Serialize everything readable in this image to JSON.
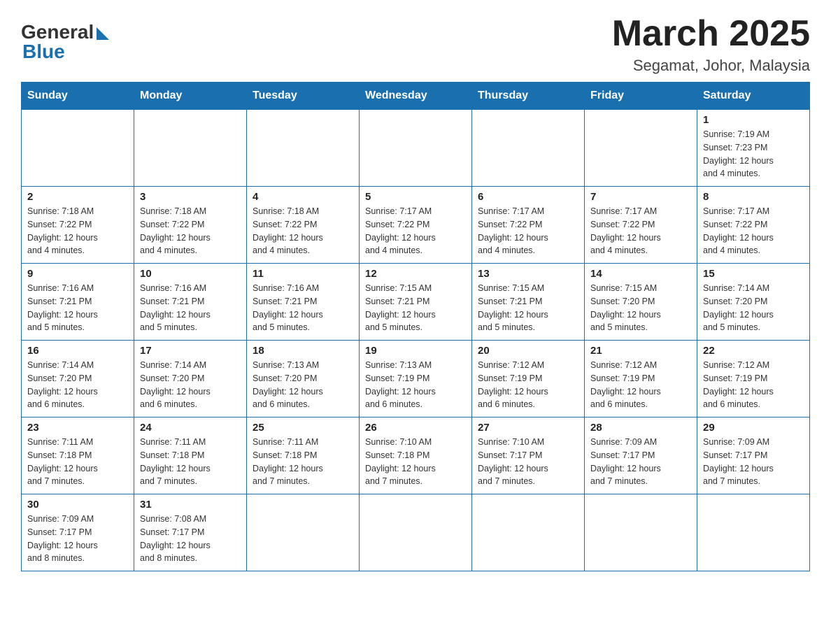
{
  "header": {
    "logo_general": "General",
    "logo_blue": "Blue",
    "main_title": "March 2025",
    "subtitle": "Segamat, Johor, Malaysia"
  },
  "weekdays": [
    "Sunday",
    "Monday",
    "Tuesday",
    "Wednesday",
    "Thursday",
    "Friday",
    "Saturday"
  ],
  "weeks": [
    [
      {
        "day": "",
        "info": ""
      },
      {
        "day": "",
        "info": ""
      },
      {
        "day": "",
        "info": ""
      },
      {
        "day": "",
        "info": ""
      },
      {
        "day": "",
        "info": ""
      },
      {
        "day": "",
        "info": ""
      },
      {
        "day": "1",
        "info": "Sunrise: 7:19 AM\nSunset: 7:23 PM\nDaylight: 12 hours\nand 4 minutes."
      }
    ],
    [
      {
        "day": "2",
        "info": "Sunrise: 7:18 AM\nSunset: 7:22 PM\nDaylight: 12 hours\nand 4 minutes."
      },
      {
        "day": "3",
        "info": "Sunrise: 7:18 AM\nSunset: 7:22 PM\nDaylight: 12 hours\nand 4 minutes."
      },
      {
        "day": "4",
        "info": "Sunrise: 7:18 AM\nSunset: 7:22 PM\nDaylight: 12 hours\nand 4 minutes."
      },
      {
        "day": "5",
        "info": "Sunrise: 7:17 AM\nSunset: 7:22 PM\nDaylight: 12 hours\nand 4 minutes."
      },
      {
        "day": "6",
        "info": "Sunrise: 7:17 AM\nSunset: 7:22 PM\nDaylight: 12 hours\nand 4 minutes."
      },
      {
        "day": "7",
        "info": "Sunrise: 7:17 AM\nSunset: 7:22 PM\nDaylight: 12 hours\nand 4 minutes."
      },
      {
        "day": "8",
        "info": "Sunrise: 7:17 AM\nSunset: 7:22 PM\nDaylight: 12 hours\nand 4 minutes."
      }
    ],
    [
      {
        "day": "9",
        "info": "Sunrise: 7:16 AM\nSunset: 7:21 PM\nDaylight: 12 hours\nand 5 minutes."
      },
      {
        "day": "10",
        "info": "Sunrise: 7:16 AM\nSunset: 7:21 PM\nDaylight: 12 hours\nand 5 minutes."
      },
      {
        "day": "11",
        "info": "Sunrise: 7:16 AM\nSunset: 7:21 PM\nDaylight: 12 hours\nand 5 minutes."
      },
      {
        "day": "12",
        "info": "Sunrise: 7:15 AM\nSunset: 7:21 PM\nDaylight: 12 hours\nand 5 minutes."
      },
      {
        "day": "13",
        "info": "Sunrise: 7:15 AM\nSunset: 7:21 PM\nDaylight: 12 hours\nand 5 minutes."
      },
      {
        "day": "14",
        "info": "Sunrise: 7:15 AM\nSunset: 7:20 PM\nDaylight: 12 hours\nand 5 minutes."
      },
      {
        "day": "15",
        "info": "Sunrise: 7:14 AM\nSunset: 7:20 PM\nDaylight: 12 hours\nand 5 minutes."
      }
    ],
    [
      {
        "day": "16",
        "info": "Sunrise: 7:14 AM\nSunset: 7:20 PM\nDaylight: 12 hours\nand 6 minutes."
      },
      {
        "day": "17",
        "info": "Sunrise: 7:14 AM\nSunset: 7:20 PM\nDaylight: 12 hours\nand 6 minutes."
      },
      {
        "day": "18",
        "info": "Sunrise: 7:13 AM\nSunset: 7:20 PM\nDaylight: 12 hours\nand 6 minutes."
      },
      {
        "day": "19",
        "info": "Sunrise: 7:13 AM\nSunset: 7:19 PM\nDaylight: 12 hours\nand 6 minutes."
      },
      {
        "day": "20",
        "info": "Sunrise: 7:12 AM\nSunset: 7:19 PM\nDaylight: 12 hours\nand 6 minutes."
      },
      {
        "day": "21",
        "info": "Sunrise: 7:12 AM\nSunset: 7:19 PM\nDaylight: 12 hours\nand 6 minutes."
      },
      {
        "day": "22",
        "info": "Sunrise: 7:12 AM\nSunset: 7:19 PM\nDaylight: 12 hours\nand 6 minutes."
      }
    ],
    [
      {
        "day": "23",
        "info": "Sunrise: 7:11 AM\nSunset: 7:18 PM\nDaylight: 12 hours\nand 7 minutes."
      },
      {
        "day": "24",
        "info": "Sunrise: 7:11 AM\nSunset: 7:18 PM\nDaylight: 12 hours\nand 7 minutes."
      },
      {
        "day": "25",
        "info": "Sunrise: 7:11 AM\nSunset: 7:18 PM\nDaylight: 12 hours\nand 7 minutes."
      },
      {
        "day": "26",
        "info": "Sunrise: 7:10 AM\nSunset: 7:18 PM\nDaylight: 12 hours\nand 7 minutes."
      },
      {
        "day": "27",
        "info": "Sunrise: 7:10 AM\nSunset: 7:17 PM\nDaylight: 12 hours\nand 7 minutes."
      },
      {
        "day": "28",
        "info": "Sunrise: 7:09 AM\nSunset: 7:17 PM\nDaylight: 12 hours\nand 7 minutes."
      },
      {
        "day": "29",
        "info": "Sunrise: 7:09 AM\nSunset: 7:17 PM\nDaylight: 12 hours\nand 7 minutes."
      }
    ],
    [
      {
        "day": "30",
        "info": "Sunrise: 7:09 AM\nSunset: 7:17 PM\nDaylight: 12 hours\nand 8 minutes."
      },
      {
        "day": "31",
        "info": "Sunrise: 7:08 AM\nSunset: 7:17 PM\nDaylight: 12 hours\nand 8 minutes."
      },
      {
        "day": "",
        "info": ""
      },
      {
        "day": "",
        "info": ""
      },
      {
        "day": "",
        "info": ""
      },
      {
        "day": "",
        "info": ""
      },
      {
        "day": "",
        "info": ""
      }
    ]
  ]
}
